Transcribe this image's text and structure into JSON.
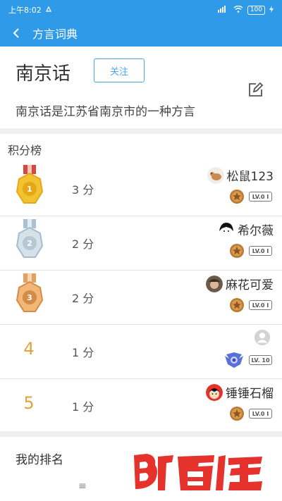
{
  "status_bar": {
    "time": "上午8:02",
    "carrier": "",
    "signal": "",
    "battery": "100"
  },
  "nav": {
    "title": "方言词典"
  },
  "dialect": {
    "name": "南京话",
    "follow_label": "关注",
    "description": "南京话是江苏省南京市的一种方言"
  },
  "leaderboard": {
    "title": "积分榜",
    "rows": [
      {
        "rank": "1",
        "medal": "gold",
        "score": "3 分",
        "name": "松鼠123",
        "level_tag": "LV.0 I",
        "avatar": "squirrel-avatar"
      },
      {
        "rank": "2",
        "medal": "silver",
        "score": "2 分",
        "name": "希尔薇",
        "level_tag": "LV.0 I",
        "avatar": "girl-avatar"
      },
      {
        "rank": "3",
        "medal": "bronze",
        "score": "2 分",
        "name": "麻花可爱",
        "level_tag": "LV.0 I",
        "avatar": "photo-avatar"
      },
      {
        "rank": "4",
        "medal": "",
        "score": "1 分",
        "name": "",
        "level_tag": "LV. 10",
        "avatar": "default-avatar"
      },
      {
        "rank": "5",
        "medal": "",
        "score": "1 分",
        "name": "锤锤石榴",
        "level_tag": "LV.0 I",
        "avatar": "cartoon-avatar"
      }
    ]
  },
  "my_rank": {
    "label": "我的排名"
  },
  "watermark": {
    "text": "百佳"
  },
  "colors": {
    "accent": "#2f9be8",
    "rank_text": "#e2a23c",
    "watermark_red": "#e5322d"
  }
}
